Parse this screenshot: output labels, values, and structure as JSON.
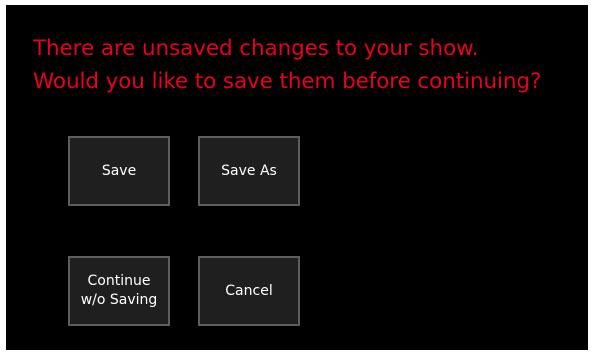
{
  "dialog": {
    "message_line_1": "There are unsaved changes to your show.",
    "message_line_2": "Would you like to save them before continuing?",
    "message_color": "#e8001c",
    "background_color": "#000000"
  },
  "buttons": {
    "save": "Save",
    "save_as": "Save As",
    "continue_line_1": "Continue",
    "continue_line_2": "w/o Saving",
    "cancel": "Cancel"
  }
}
